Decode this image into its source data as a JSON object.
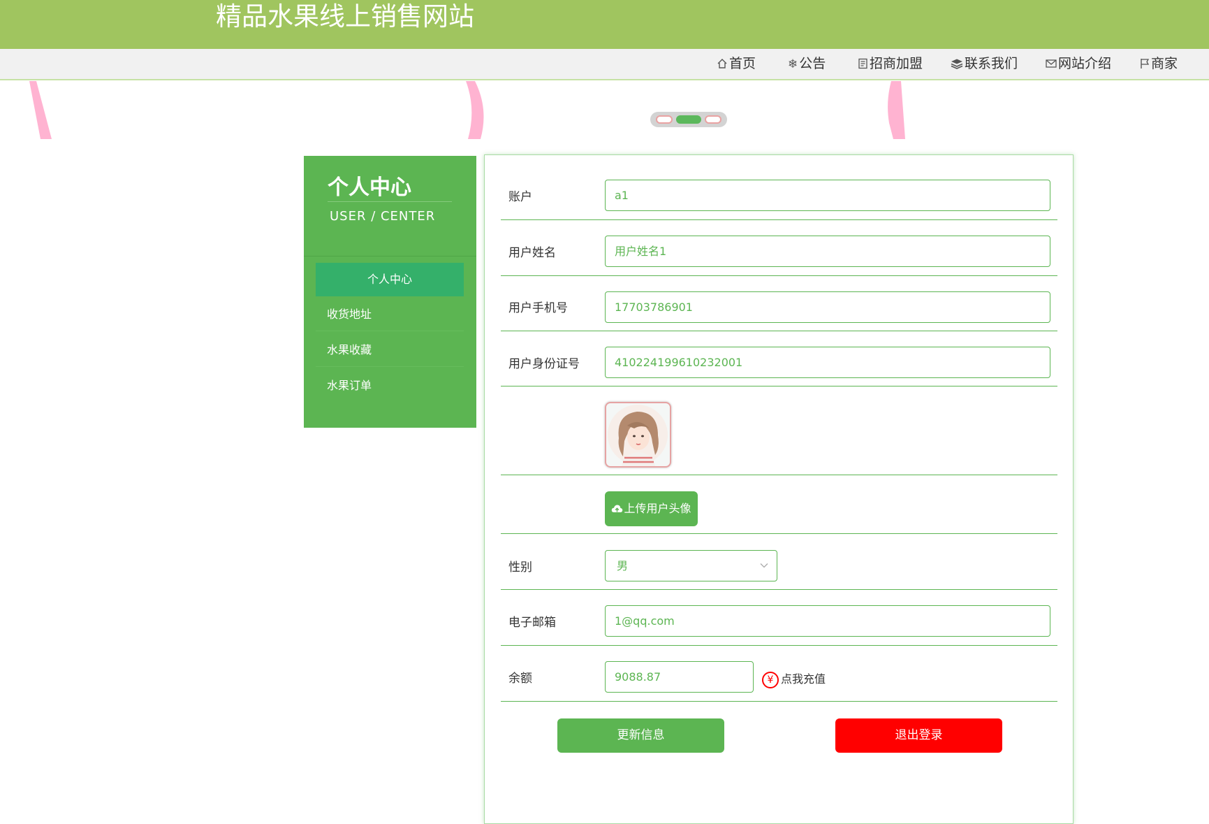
{
  "header": {
    "title": "精品水果线上销售网站"
  },
  "nav": {
    "items": [
      {
        "icon": "home-icon",
        "label": "首页"
      },
      {
        "icon": "snowflake-icon",
        "label": "公告"
      },
      {
        "icon": "document-icon",
        "label": "招商加盟"
      },
      {
        "icon": "layers-icon",
        "label": "联系我们"
      },
      {
        "icon": "envelope-icon",
        "label": "网站介绍"
      },
      {
        "icon": "flag-icon",
        "label": "商家"
      }
    ]
  },
  "carousel": {
    "slide_count": 3,
    "active_index": 1
  },
  "sidebar": {
    "title": "个人中心",
    "subtitle": "USER / CENTER",
    "items": [
      {
        "label": "个人中心",
        "active": true
      },
      {
        "label": "收货地址",
        "active": false
      },
      {
        "label": "水果收藏",
        "active": false
      },
      {
        "label": "水果订单",
        "active": false
      }
    ]
  },
  "form": {
    "account": {
      "label": "账户",
      "value": "a1"
    },
    "username": {
      "label": "用户姓名",
      "value": "用户姓名1"
    },
    "phone": {
      "label": "用户手机号",
      "value": "17703786901"
    },
    "id_number": {
      "label": "用户身份证号",
      "value": "410224199610232001"
    },
    "upload_label": "上传用户头像",
    "gender": {
      "label": "性别",
      "value": "男"
    },
    "email": {
      "label": "电子邮箱",
      "value": "1@qq.com"
    },
    "balance": {
      "label": "余额",
      "value": "9088.87",
      "recharge_label": "点我充值",
      "recharge_icon": "yen-icon"
    },
    "update_label": "更新信息",
    "logout_label": "退出登录"
  },
  "colors": {
    "header": "#a0c55f",
    "primary": "#5cb552",
    "active": "#34b06a",
    "danger": "#ff0000"
  }
}
